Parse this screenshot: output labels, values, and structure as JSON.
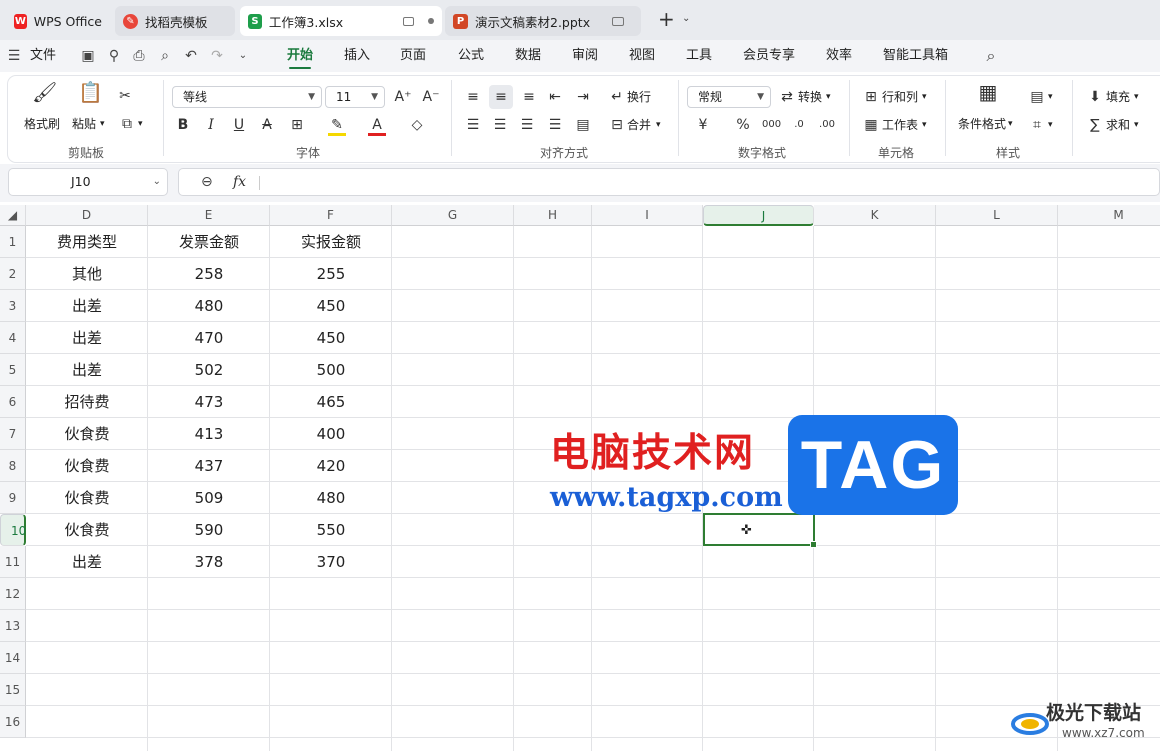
{
  "tabs": [
    {
      "label": "WPS Office",
      "icon": "wps-logo-icon"
    },
    {
      "label": "找稻壳模板",
      "icon": "docer-icon"
    },
    {
      "label": "工作簿3.xlsx",
      "icon": "spreadsheet-icon"
    },
    {
      "label": "演示文稿素材2.pptx",
      "icon": "presentation-icon"
    }
  ],
  "menu": {
    "file": "文件",
    "items": [
      "开始",
      "插入",
      "页面",
      "公式",
      "数据",
      "审阅",
      "视图",
      "工具",
      "会员专享",
      "效率",
      "智能工具箱"
    ],
    "active": "开始"
  },
  "ribbon": {
    "clipboard": {
      "format_painter": "格式刷",
      "paste": "粘贴",
      "group": "剪贴板"
    },
    "font": {
      "name": "等线",
      "size": "11",
      "group": "字体"
    },
    "align": {
      "wrap": "换行",
      "merge": "合并",
      "group": "对齐方式"
    },
    "number": {
      "format": "常规",
      "convert": "转换",
      "group": "数字格式"
    },
    "cells": {
      "rows_cols": "行和列",
      "sheet": "工作表",
      "group": "单元格"
    },
    "styles": {
      "cond_format": "条件格式",
      "group": "样式"
    },
    "edit": {
      "fill": "填充",
      "sum": "求和"
    }
  },
  "formula_bar": {
    "name_box": "J10",
    "fx": "fx"
  },
  "grid": {
    "columns": [
      "D",
      "E",
      "F",
      "G",
      "H",
      "I",
      "J",
      "K",
      "L",
      "M"
    ],
    "selected_column": "J",
    "rows": [
      "1",
      "2",
      "3",
      "4",
      "5",
      "6",
      "7",
      "8",
      "9",
      "10",
      "11",
      "12",
      "13",
      "14",
      "15",
      "16"
    ],
    "selected_row": "10",
    "headers": [
      "费用类型",
      "发票金额",
      "实报金额"
    ],
    "data": [
      [
        "其他",
        "258",
        "255"
      ],
      [
        "出差",
        "480",
        "450"
      ],
      [
        "出差",
        "470",
        "450"
      ],
      [
        "出差",
        "502",
        "500"
      ],
      [
        "招待费",
        "473",
        "465"
      ],
      [
        "伙食费",
        "413",
        "400"
      ],
      [
        "伙食费",
        "437",
        "420"
      ],
      [
        "伙食费",
        "509",
        "480"
      ],
      [
        "伙食费",
        "590",
        "550"
      ],
      [
        "出差",
        "378",
        "370"
      ]
    ]
  },
  "watermark": {
    "cn": "电脑技术网",
    "url": "www.tagxp.com",
    "tag": "TAG",
    "site_cn": "极光下载站",
    "site_url": "www.xz7.com"
  },
  "colors": {
    "accent": "#1b7a3e",
    "active_border": "#2e7d32"
  }
}
